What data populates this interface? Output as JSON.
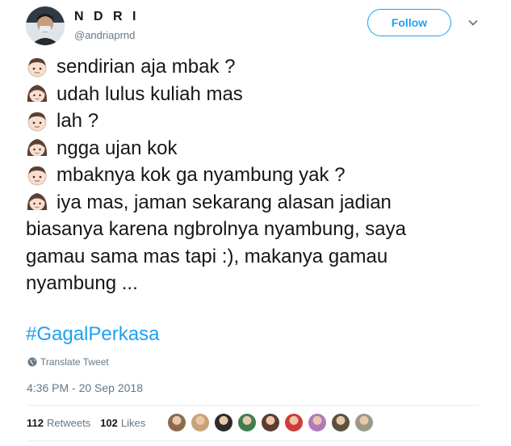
{
  "user": {
    "display_name": "N D R I",
    "handle": "@andriaprnd"
  },
  "actions": {
    "follow_label": "Follow",
    "caret_icon": "chevron-down-icon"
  },
  "tweet": {
    "lines": [
      {
        "speaker": "boy",
        "icon": "boy-emoji-icon",
        "text": "sendirian aja mbak ?"
      },
      {
        "speaker": "girl",
        "icon": "girl-emoji-icon",
        "text": "udah lulus kuliah mas"
      },
      {
        "speaker": "boy",
        "icon": "boy-emoji-icon",
        "text": "lah ?"
      },
      {
        "speaker": "girl",
        "icon": "girl-emoji-icon",
        "text": "ngga ujan kok"
      },
      {
        "speaker": "boy",
        "icon": "boy-emoji-icon",
        "text": "mbaknya kok ga nyambung yak ?"
      },
      {
        "speaker": "girl",
        "icon": "girl-emoji-icon",
        "text": "iya mas, jaman sekarang alasan jadian"
      }
    ],
    "continuation": [
      "biasanya karena ngbrolnya nyambung, saya",
      "gamau sama mas tapi :), makanya gamau",
      "nyambung ..."
    ],
    "hashtag": "#GagalPerkasa",
    "translate_label": "Translate Tweet",
    "timestamp": "4:36 PM - 20 Sep 2018"
  },
  "stats": {
    "retweets_count": "112",
    "retweets_label": "Retweets",
    "likes_count": "102",
    "likes_label": "Likes"
  },
  "colors": {
    "accent": "#1da1f2",
    "secondary_text": "#657786",
    "divider": "#e6ecf0"
  },
  "likers": [
    {
      "name": "liker-avatar-1",
      "color": "#8a6a4a"
    },
    {
      "name": "liker-avatar-2",
      "color": "#c9a27a"
    },
    {
      "name": "liker-avatar-3",
      "color": "#2b2b2b"
    },
    {
      "name": "liker-avatar-4",
      "color": "#3f7d4e"
    },
    {
      "name": "liker-avatar-5",
      "color": "#5a3d33"
    },
    {
      "name": "liker-avatar-6",
      "color": "#d23a3a"
    },
    {
      "name": "liker-avatar-7",
      "color": "#b07ab8"
    },
    {
      "name": "liker-avatar-8",
      "color": "#5c5040"
    },
    {
      "name": "liker-avatar-9",
      "color": "#9a9a8a"
    }
  ]
}
